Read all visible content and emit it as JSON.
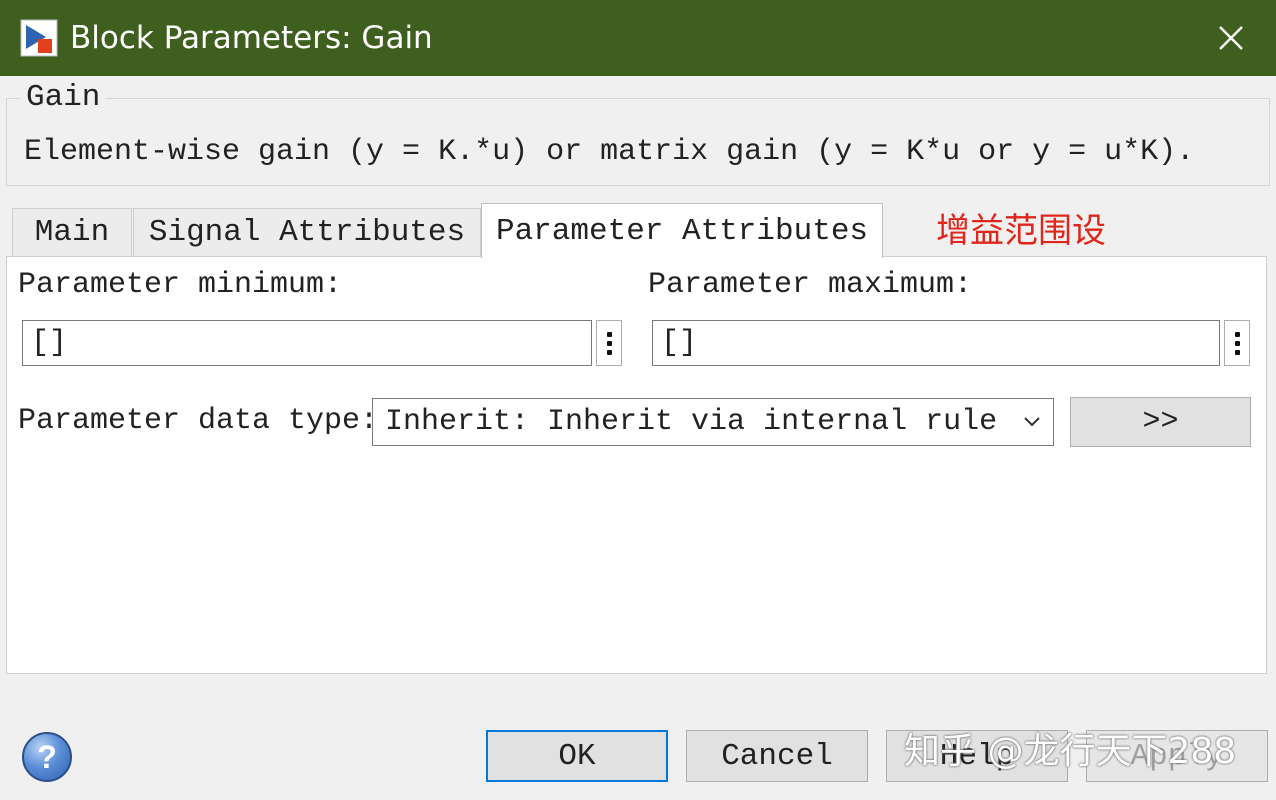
{
  "window": {
    "title": "Block Parameters: Gain"
  },
  "description": {
    "legend": "Gain",
    "text": "Element-wise gain (y = K.*u) or matrix gain (y = K*u or y = u*K)."
  },
  "tabs": [
    {
      "label": "Main",
      "selected": false
    },
    {
      "label": "Signal Attributes",
      "selected": false
    },
    {
      "label": "Parameter Attributes",
      "selected": true
    }
  ],
  "annotation": "增益范围设",
  "parameter_attributes": {
    "minimum": {
      "label": "Parameter minimum:",
      "value": "[]"
    },
    "maximum": {
      "label": "Parameter maximum:",
      "value": "[]"
    },
    "data_type": {
      "label": "Parameter data type:",
      "selected": "Inherit: Inherit via internal rule",
      "assistant_label": ">>"
    }
  },
  "footer": {
    "help_icon": "?",
    "ok": "OK",
    "cancel": "Cancel",
    "help": "Help",
    "apply": "Apply"
  },
  "watermark": "知乎 @龙行天下288",
  "colors": {
    "titlebar": "#3e5f1d",
    "annotation": "#e0251b",
    "default_button_border": "#0078d7"
  }
}
